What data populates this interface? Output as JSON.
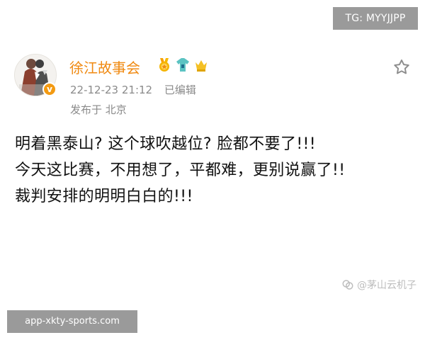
{
  "watermarks": {
    "tg": "TG: MYYJJPP",
    "site": "app-xkty-sports.com",
    "author": "@茅山云机子"
  },
  "post": {
    "author_name": "徐江故事会",
    "timestamp": "22-12-23 21:12",
    "edited_label": "已编辑",
    "location": "发布于 北京",
    "lines": [
      "明着黑泰山? 这个球吹越位? 脸都不要了!!!",
      "今天这比赛，不用想了，平都难，更别说赢了!!",
      "裁判安排的明明白白的!!!"
    ]
  },
  "icons": {
    "verified": "verified-badge-icon",
    "badge_one": "medal-icon",
    "badge_two": "shirt-icon",
    "badge_three": "crown-icon",
    "favorite": "star-icon"
  },
  "colors": {
    "username": "#f08a12",
    "meta_text": "#8a8a8a",
    "watermark_bg": "#9a9a9a"
  }
}
